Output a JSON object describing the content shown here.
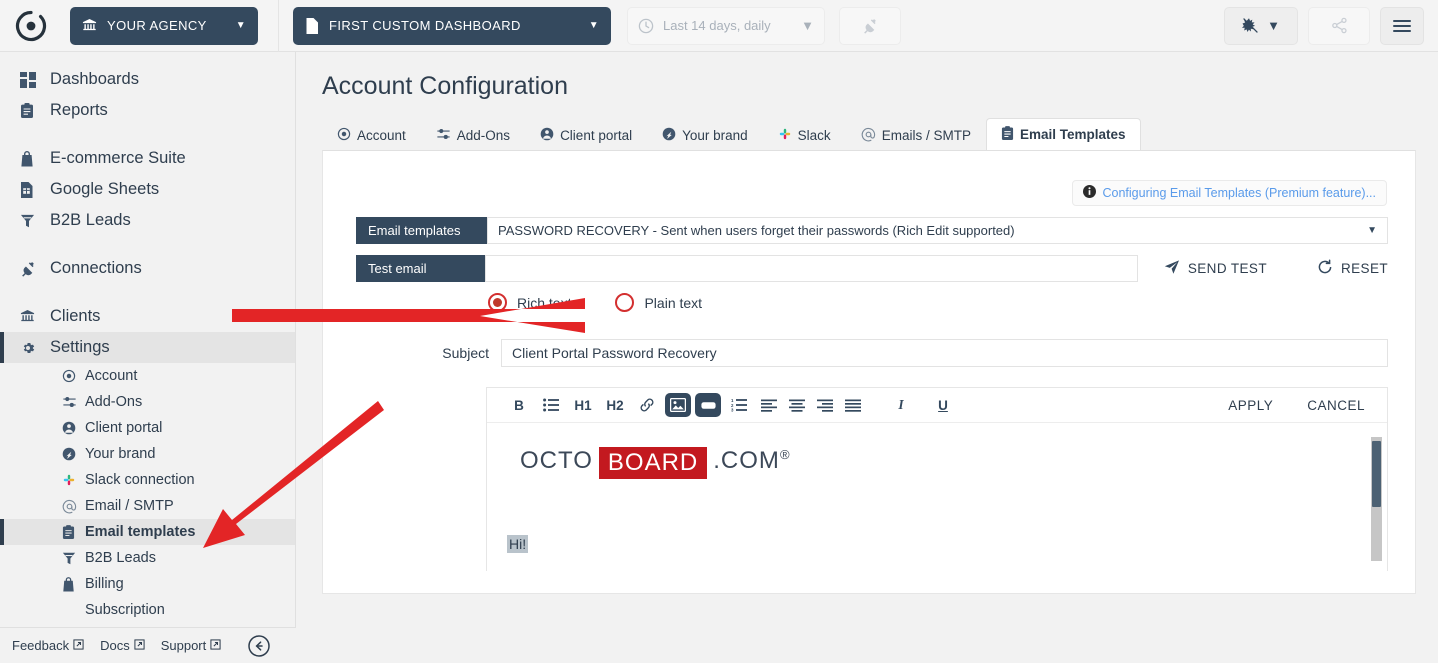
{
  "topbar": {
    "logo_icon": "octoboard-logo-icon",
    "agency_button": {
      "label": "YOUR AGENCY",
      "icon": "bank-icon",
      "caret": "▼"
    },
    "dashboard_button": {
      "label": "FIRST CUSTOM DASHBOARD",
      "icon": "document-icon",
      "caret": "▼"
    },
    "daterange_button": {
      "label": "Last 14 days, daily",
      "icon": "clock-icon",
      "caret": "▼"
    },
    "connector_button": {
      "icon": "plug-icon"
    },
    "theme_button": {
      "icon": "theme-icon",
      "caret": "▼"
    },
    "share_button": {
      "icon": "share-icon"
    },
    "menu_button": {
      "icon": "hamburger-icon"
    },
    "colors": {
      "dark": "#34495e",
      "bar_bg": "#f4f4f4"
    }
  },
  "sidebar": {
    "items": [
      {
        "label": "Dashboards",
        "icon": "grid-icon",
        "active": false
      },
      {
        "label": "Reports",
        "icon": "clipboard-icon",
        "active": false
      },
      {
        "label": "E-commerce Suite",
        "icon": "bag-icon",
        "active": false
      },
      {
        "label": "Google Sheets",
        "icon": "sheets-icon",
        "active": false
      },
      {
        "label": "B2B Leads",
        "icon": "funnel-icon",
        "active": false
      },
      {
        "label": "Connections",
        "icon": "plug-icon",
        "active": false
      },
      {
        "label": "Clients",
        "icon": "bank-icon",
        "active": false
      },
      {
        "label": "Settings",
        "icon": "gear-icon",
        "active": true
      }
    ],
    "sub_items": [
      {
        "label": "Account",
        "icon": "target-icon",
        "active": false
      },
      {
        "label": "Add-Ons",
        "icon": "sliders-icon",
        "active": false
      },
      {
        "label": "Client portal",
        "icon": "person-icon",
        "active": false
      },
      {
        "label": "Your brand",
        "icon": "brand-icon",
        "active": false
      },
      {
        "label": "Slack connection",
        "icon": "slack-icon",
        "active": false
      },
      {
        "label": "Email / SMTP",
        "icon": "at-icon",
        "active": false
      },
      {
        "label": "Email templates",
        "icon": "clipboard-icon",
        "active": true
      },
      {
        "label": "B2B Leads",
        "icon": "funnel-icon",
        "active": false
      },
      {
        "label": "Billing",
        "icon": "bag-icon",
        "active": false
      },
      {
        "label": "Subscription",
        "icon": "",
        "active": false
      }
    ],
    "footer": {
      "feedback": "Feedback",
      "docs": "Docs",
      "support": "Support",
      "external_glyph": "↗",
      "collapse_icon": "collapse-left-icon"
    }
  },
  "main": {
    "page_title": "Account Configuration",
    "tabs": [
      {
        "label": "Account",
        "icon": "target-icon",
        "active": false
      },
      {
        "label": "Add-Ons",
        "icon": "sliders-icon",
        "active": false
      },
      {
        "label": "Client portal",
        "icon": "person-icon",
        "active": false
      },
      {
        "label": "Your brand",
        "icon": "brand-icon",
        "active": false
      },
      {
        "label": "Slack",
        "icon": "slack-icon",
        "active": false
      },
      {
        "label": "Emails / SMTP",
        "icon": "at-icon",
        "active": false
      },
      {
        "label": "Email Templates",
        "icon": "clipboard-icon",
        "active": true
      }
    ],
    "info_link": {
      "text": "Configuring Email Templates (Premium feature)...",
      "icon": "info-icon",
      "color": "#5a9bea"
    },
    "template_field": {
      "label": "Email templates",
      "value": "PASSWORD RECOVERY - Sent when users forget their passwords (Rich Edit supported)",
      "caret": "▼"
    },
    "test_email_field": {
      "label": "Test email",
      "value": "",
      "placeholder": ""
    },
    "send_test": {
      "label": "SEND TEST",
      "icon": "send-icon"
    },
    "reset": {
      "label": "RESET",
      "icon": "refresh-icon"
    },
    "format_options": [
      {
        "label": "Rich text",
        "selected": true
      },
      {
        "label": "Plain text",
        "selected": false
      }
    ],
    "subject_field": {
      "label": "Subject",
      "value": "Client Portal Password Recovery"
    },
    "editor": {
      "toolbar": [
        {
          "name": "bold-icon",
          "glyph": "B",
          "active": false
        },
        {
          "name": "bullet-list-icon",
          "glyph": "",
          "active": false
        },
        {
          "name": "heading-1-icon",
          "glyph": "H1",
          "active": false
        },
        {
          "name": "heading-2-icon",
          "glyph": "H2",
          "active": false
        },
        {
          "name": "link-icon",
          "glyph": "",
          "active": false
        },
        {
          "name": "image-icon",
          "glyph": "",
          "active": true
        },
        {
          "name": "button-icon",
          "glyph": "",
          "active": true
        },
        {
          "name": "numbered-list-icon",
          "glyph": "",
          "active": false
        },
        {
          "name": "align-left-icon",
          "glyph": "",
          "active": false
        },
        {
          "name": "align-center-icon",
          "glyph": "",
          "active": false
        },
        {
          "name": "align-right-icon",
          "glyph": "",
          "active": false
        },
        {
          "name": "align-justify-icon",
          "glyph": "",
          "active": false
        },
        {
          "name": "italic-icon",
          "glyph": "I",
          "active": false
        },
        {
          "name": "underline-icon",
          "glyph": "U",
          "active": false
        }
      ],
      "apply_label": "APPLY",
      "cancel_label": "CANCEL",
      "content": {
        "logo_part1": "OCTO",
        "logo_part2": "BOARD",
        "logo_part3": ".COM",
        "logo_registered": "®",
        "logo_highlight_color": "#c3191f",
        "body_text": "Hi!"
      }
    }
  },
  "annotations": {
    "arrow_color": "#e32526",
    "arrow_horizontal": "points at Rich text radio",
    "arrow_diagonal": "points at Email templates sidebar item"
  }
}
